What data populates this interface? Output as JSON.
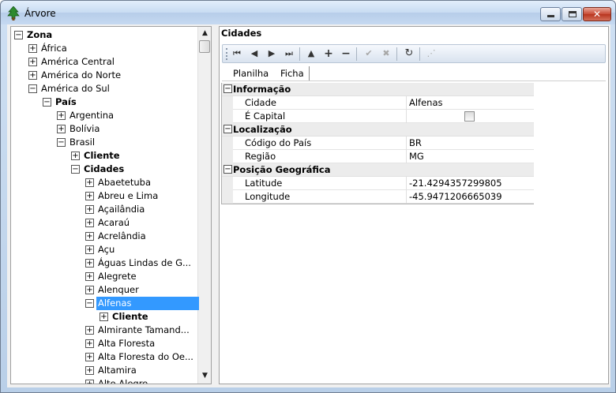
{
  "window": {
    "title": "Árvore",
    "app_icon": "tree-icon",
    "controls": {
      "minimize": "minimize-icon",
      "maximize": "maximize-icon",
      "close": "close-icon"
    }
  },
  "tree": {
    "nodes": [
      {
        "label": "Zona",
        "expander": "−",
        "bold": true
      },
      {
        "label": "África",
        "expander": "+"
      },
      {
        "label": "América Central",
        "expander": "+"
      },
      {
        "label": "América do Norte",
        "expander": "+"
      },
      {
        "label": "América do Sul",
        "expander": "−"
      },
      {
        "label": "País",
        "expander": "−",
        "bold": true
      },
      {
        "label": "Argentina",
        "expander": "+"
      },
      {
        "label": "Bolívia",
        "expander": "+"
      },
      {
        "label": "Brasil",
        "expander": "−"
      },
      {
        "label": "Cliente",
        "expander": "+",
        "bold": true
      },
      {
        "label": "Cidades",
        "expander": "−",
        "bold": true
      },
      {
        "label": "Abaetetuba",
        "expander": "+"
      },
      {
        "label": "Abreu e Lima",
        "expander": "+"
      },
      {
        "label": "Açailândia",
        "expander": "+"
      },
      {
        "label": "Acaraú",
        "expander": "+"
      },
      {
        "label": "Acrelândia",
        "expander": "+"
      },
      {
        "label": "Açu",
        "expander": "+"
      },
      {
        "label": "Águas Lindas de G...",
        "expander": "+"
      },
      {
        "label": "Alegrete",
        "expander": "+"
      },
      {
        "label": "Alenquer",
        "expander": "+"
      },
      {
        "label": "Alfenas",
        "expander": "−",
        "selected": true
      },
      {
        "label": "Cliente",
        "expander": "+",
        "bold": true
      },
      {
        "label": "Almirante Tamand...",
        "expander": "+"
      },
      {
        "label": "Alta Floresta",
        "expander": "+"
      },
      {
        "label": "Alta Floresta do Oe...",
        "expander": "+"
      },
      {
        "label": "Altamira",
        "expander": "+"
      },
      {
        "label": "Alto Alegre",
        "expander": "+"
      }
    ],
    "scrollbar": {
      "up_icon": "scroll-up-icon",
      "down_icon": "scroll-down-icon"
    }
  },
  "panel": {
    "title": "Cidades",
    "toolbar": [
      "first-record-icon",
      "prior-record-icon",
      "next-record-icon",
      "last-record-icon",
      "move-up-icon",
      "add-icon",
      "remove-icon",
      "confirm-icon",
      "cancel-icon",
      "refresh-icon",
      "disabled-action-icon"
    ],
    "tabs": {
      "planilha": "Planilha",
      "ficha": "Ficha"
    },
    "groups": [
      {
        "title": "Informação",
        "expander": "−",
        "rows": [
          {
            "name": "Cidade",
            "value": "Alfenas"
          },
          {
            "name": "É Capital",
            "value": "",
            "checkbox": true,
            "checked": false
          }
        ]
      },
      {
        "title": "Localização",
        "expander": "−",
        "rows": [
          {
            "name": "Código do País",
            "value": "BR"
          },
          {
            "name": "Região",
            "value": "MG"
          }
        ]
      },
      {
        "title": "Posição Geográfica",
        "expander": "−",
        "rows": [
          {
            "name": "Latitude",
            "value": "-21.4294357299805"
          },
          {
            "name": "Longitude",
            "value": "-45.9471206665039"
          }
        ]
      }
    ]
  },
  "colors": {
    "selection": "#3399ff",
    "window_frame": "#b9cfe8",
    "category_bg": "#ececec"
  }
}
